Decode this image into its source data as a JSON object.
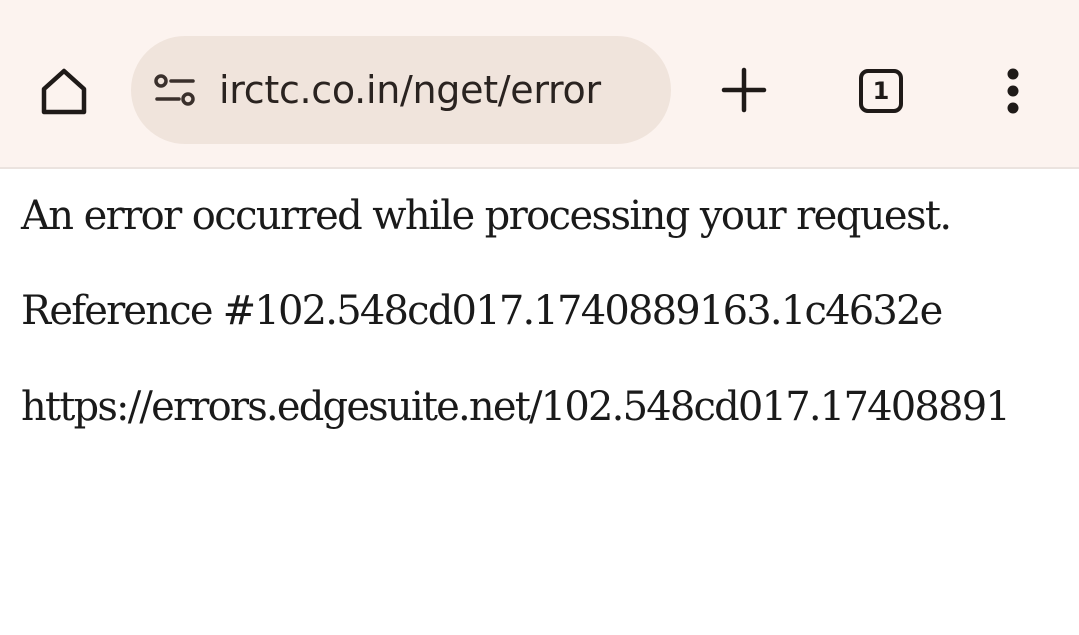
{
  "browser": {
    "url": "irctc.co.in/nget/error",
    "tab_count": "1",
    "icons": {
      "home": "home-icon",
      "site_info": "tune-icon",
      "new_tab": "plus-icon",
      "tabs": "tab-switcher-icon",
      "menu": "more-vert-icon"
    }
  },
  "page": {
    "message": "An error occurred while processing your request.",
    "reference": "Reference #102.548cd017.1740889163.1c4632e",
    "link": "https://errors.edgesuite.net/102.548cd017.17408891"
  },
  "colors": {
    "toolbar_bg": "#fcf3ef",
    "omnibox_bg": "#f0e4dc",
    "text": "#1a1a1a"
  }
}
